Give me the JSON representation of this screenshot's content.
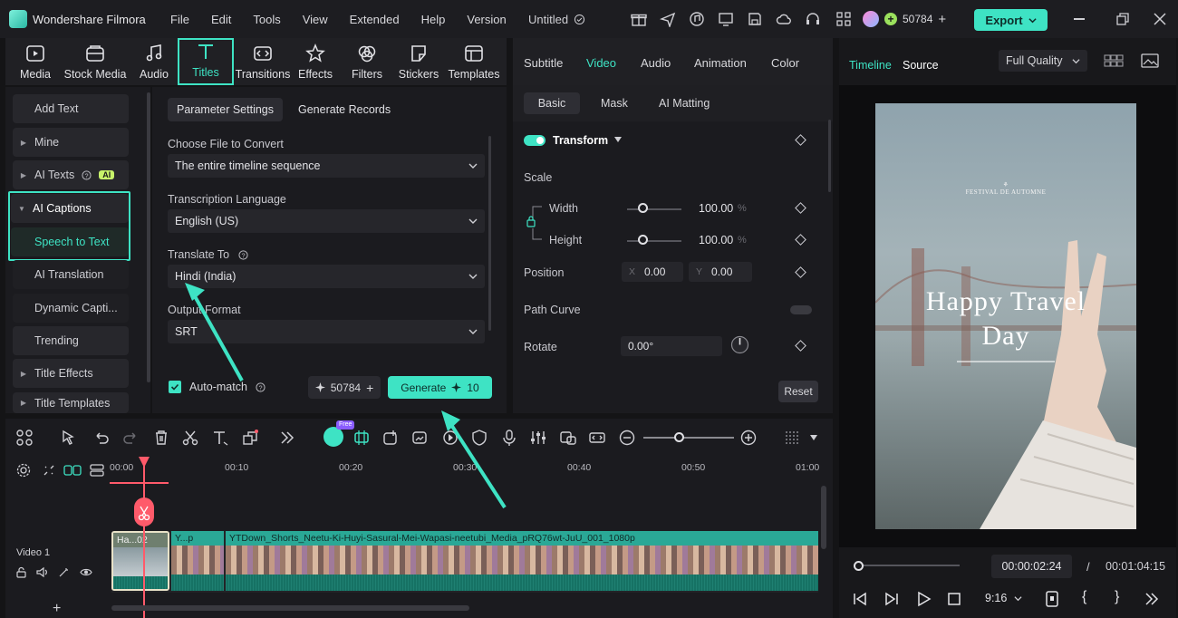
{
  "titlebar": {
    "app_name": "Wondershare Filmora",
    "menu": [
      "File",
      "Edit",
      "Tools",
      "View",
      "Extended",
      "Help",
      "Version"
    ],
    "project": "Untitled",
    "credits": "50784",
    "export": "Export"
  },
  "media_tabs": [
    {
      "label": "Media",
      "icon": "media-icon"
    },
    {
      "label": "Stock Media",
      "icon": "stock-media-icon"
    },
    {
      "label": "Audio",
      "icon": "music-note-icon"
    },
    {
      "label": "Titles",
      "icon": "titles-t-icon"
    },
    {
      "label": "Transitions",
      "icon": "transitions-icon"
    },
    {
      "label": "Effects",
      "icon": "effects-icon"
    },
    {
      "label": "Filters",
      "icon": "filters-icon"
    },
    {
      "label": "Stickers",
      "icon": "stickers-icon"
    },
    {
      "label": "Templates",
      "icon": "templates-icon"
    }
  ],
  "active_media_tab": "Titles",
  "sidebar": {
    "items": [
      {
        "label": "Add Text"
      },
      {
        "label": "Mine"
      },
      {
        "label": "AI Texts",
        "badge": "AI"
      },
      {
        "label": "AI Captions"
      },
      {
        "label": "Speech to Text"
      },
      {
        "label": "AI Translation"
      },
      {
        "label": "Dynamic Capti..."
      },
      {
        "label": "Trending"
      },
      {
        "label": "Title Effects"
      },
      {
        "label": "Title Templates"
      }
    ]
  },
  "params": {
    "tabs": [
      "Parameter Settings",
      "Generate Records"
    ],
    "file_label": "Choose File to Convert",
    "file_value": "The entire timeline sequence",
    "lang_label": "Transcription Language",
    "lang_value": "English (US)",
    "translate_label": "Translate To",
    "translate_value": "Hindi (India)",
    "format_label": "Output Format",
    "format_value": "SRT",
    "auto_match": "Auto-match",
    "credits": "50784",
    "generate": "Generate",
    "generate_cost": "10"
  },
  "properties": {
    "tabs": [
      "Subtitle",
      "Video",
      "Audio",
      "Animation",
      "Color"
    ],
    "active_tab": "Video",
    "sub_tabs": [
      "Basic",
      "Mask",
      "AI Matting"
    ],
    "transform": "Transform",
    "scale": "Scale",
    "width_label": "Width",
    "width_value": "100.00",
    "height_label": "Height",
    "height_value": "100.00",
    "percent": "%",
    "position": "Position",
    "pos_x_label": "X",
    "pos_x": "0.00",
    "pos_y_label": "Y",
    "pos_y": "0.00",
    "path_curve": "Path Curve",
    "rotate": "Rotate",
    "rotate_value": "0.00°",
    "reset": "Reset"
  },
  "preview": {
    "tabs": [
      "Timeline",
      "Source"
    ],
    "quality": "Full Quality",
    "title_line1": "Happy Travel",
    "title_line2": "Day",
    "current_time": "00:00:02:24",
    "separator": "/",
    "total_time": "00:01:04:15",
    "ratio": "9:16"
  },
  "timeline": {
    "ruler": [
      "00:00",
      "00:10",
      "00:20",
      "00:30",
      "00:40",
      "00:50",
      "01:00"
    ],
    "track_label": "Video 1",
    "clips": [
      {
        "label": "Ha...02"
      },
      {
        "label": "Y...p"
      },
      {
        "label": "YTDown_Shorts_Neetu-Ki-Huyi-Sasural-Mei-Wapasi-neetubi_Media_pRQ76wt-JuU_001_1080p"
      }
    ],
    "free_badge": "Free"
  },
  "colors": {
    "accent": "#3ee3c4",
    "background": "#141416",
    "panel": "#1b1b1f",
    "playhead": "#ff5a6a"
  }
}
